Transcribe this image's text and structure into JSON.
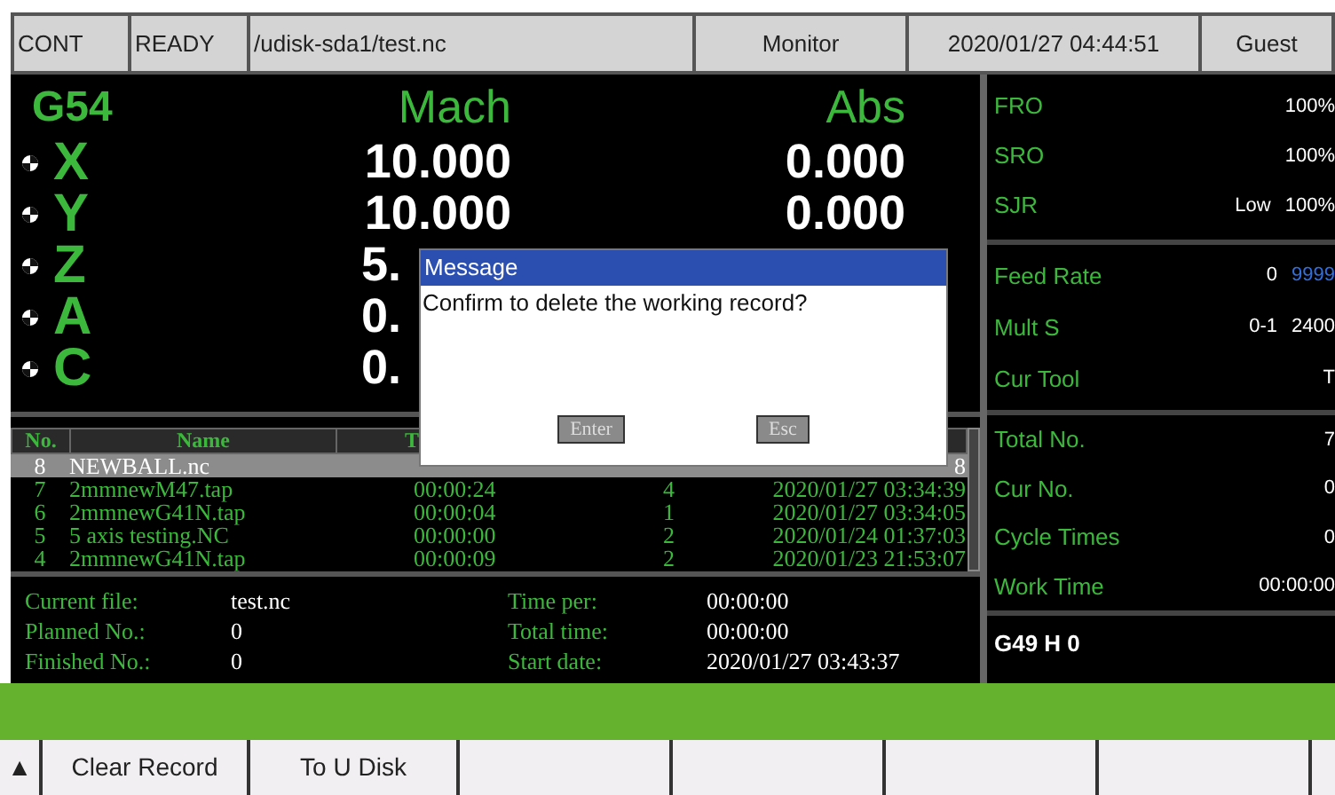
{
  "status_bar": [
    "CONT",
    "READY",
    "/udisk-sda1/test.nc",
    "Monitor",
    "2020/01/27 04:44:51",
    "Guest"
  ],
  "coordinates": {
    "system": "G54",
    "columns": [
      "Mach",
      "Abs"
    ],
    "axes": [
      {
        "axis": "X",
        "mach": "10.000",
        "abs": "0.000"
      },
      {
        "axis": "Y",
        "mach": "10.000",
        "abs": "0.000"
      },
      {
        "axis": "Z",
        "mach": "5."
      },
      {
        "axis": "A",
        "mach": "0."
      },
      {
        "axis": "C",
        "mach": "0."
      }
    ]
  },
  "records": {
    "columns": [
      "No.",
      "Name",
      "T"
    ],
    "rows": [
      {
        "no": "8",
        "name": "NEWBALL.nc",
        "date": "8",
        "selected": true
      },
      {
        "no": "7",
        "name": "2mmnewM47.tap",
        "time": "00:00:24",
        "count": "4",
        "date": "2020/01/27 03:34:39",
        "selected": false
      },
      {
        "no": "6",
        "name": "2mmnewG41N.tap",
        "time": "00:00:04",
        "count": "1",
        "date": "2020/01/27 03:34:05",
        "selected": false
      },
      {
        "no": "5",
        "name": "5 axis testing.NC",
        "time": "00:00:00",
        "count": "2",
        "date": "2020/01/24 01:37:03",
        "selected": false
      },
      {
        "no": "4",
        "name": "2mmnewG41N.tap",
        "time": "00:00:09",
        "count": "2",
        "date": "2020/01/23 21:53:07",
        "selected": false
      }
    ]
  },
  "job_info": {
    "left": [
      {
        "label": "Current file:",
        "value": "test.nc"
      },
      {
        "label": "Planned No.:",
        "value": "0"
      },
      {
        "label": "Finished No.:",
        "value": "0"
      }
    ],
    "right": [
      {
        "label": "Time per:",
        "value": "00:00:00"
      },
      {
        "label": "Total time:",
        "value": "00:00:00"
      },
      {
        "label": "Start date:",
        "value": "2020/01/27 03:43:37"
      }
    ]
  },
  "overrides": [
    {
      "label": "FRO",
      "value": "100%"
    },
    {
      "label": "SRO",
      "value": "100%"
    },
    {
      "label": "SJR",
      "mode": "Low",
      "value": "100%"
    }
  ],
  "spindle": [
    {
      "label": "Feed Rate",
      "value": "0",
      "limit": "9999"
    },
    {
      "label": "Mult S",
      "mode": "0-1",
      "value": "2400"
    },
    {
      "label": "Cur Tool",
      "value": "T"
    }
  ],
  "counters": [
    {
      "label": "Total No.",
      "value": "7"
    },
    {
      "label": "Cur No.",
      "value": "0"
    },
    {
      "label": "Cycle Times",
      "value": "0"
    },
    {
      "label": "Work Time",
      "value": "00:00:00"
    }
  ],
  "offset": "G49 H 0",
  "dialog": {
    "title": "Message",
    "text": "Confirm to delete the working record?",
    "buttons": [
      "Enter",
      "Esc"
    ]
  },
  "softkeys": [
    {
      "label": "▲"
    },
    {
      "label": "Clear Record"
    },
    {
      "label": "To U Disk"
    }
  ]
}
